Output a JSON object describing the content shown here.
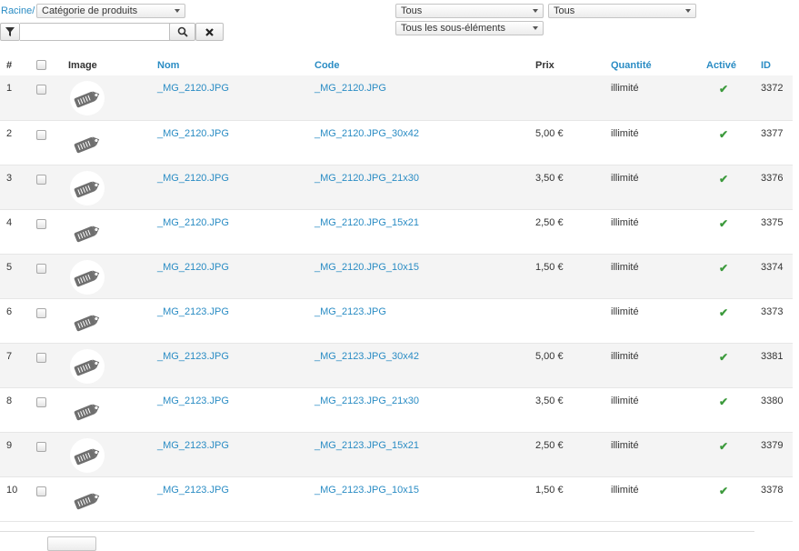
{
  "breadcrumb": {
    "root": "Racine/"
  },
  "filters": {
    "category_select": "Catégorie de produits",
    "select_tous_1": "Tous",
    "select_tous_2": "Tous",
    "select_subitems": "Tous les sous-éléments",
    "search_value": ""
  },
  "table": {
    "headers": {
      "index": "#",
      "image": "Image",
      "nom": "Nom",
      "code": "Code",
      "prix": "Prix",
      "quantite": "Quantité",
      "active": "Activé",
      "id": "ID"
    },
    "rows": [
      {
        "index": "1",
        "nom": "_MG_2120.JPG",
        "code": "_MG_2120.JPG",
        "prix": "",
        "quantite": "illimité",
        "active": true,
        "id": "3372"
      },
      {
        "index": "2",
        "nom": "_MG_2120.JPG",
        "code": "_MG_2120.JPG_30x42",
        "prix": "5,00 €",
        "quantite": "illimité",
        "active": true,
        "id": "3377"
      },
      {
        "index": "3",
        "nom": "_MG_2120.JPG",
        "code": "_MG_2120.JPG_21x30",
        "prix": "3,50 €",
        "quantite": "illimité",
        "active": true,
        "id": "3376"
      },
      {
        "index": "4",
        "nom": "_MG_2120.JPG",
        "code": "_MG_2120.JPG_15x21",
        "prix": "2,50 €",
        "quantite": "illimité",
        "active": true,
        "id": "3375"
      },
      {
        "index": "5",
        "nom": "_MG_2120.JPG",
        "code": "_MG_2120.JPG_10x15",
        "prix": "1,50 €",
        "quantite": "illimité",
        "active": true,
        "id": "3374"
      },
      {
        "index": "6",
        "nom": "_MG_2123.JPG",
        "code": "_MG_2123.JPG",
        "prix": "",
        "quantite": "illimité",
        "active": true,
        "id": "3373"
      },
      {
        "index": "7",
        "nom": "_MG_2123.JPG",
        "code": "_MG_2123.JPG_30x42",
        "prix": "5,00 €",
        "quantite": "illimité",
        "active": true,
        "id": "3381"
      },
      {
        "index": "8",
        "nom": "_MG_2123.JPG",
        "code": "_MG_2123.JPG_21x30",
        "prix": "3,50 €",
        "quantite": "illimité",
        "active": true,
        "id": "3380"
      },
      {
        "index": "9",
        "nom": "_MG_2123.JPG",
        "code": "_MG_2123.JPG_15x21",
        "prix": "2,50 €",
        "quantite": "illimité",
        "active": true,
        "id": "3379"
      },
      {
        "index": "10",
        "nom": "_MG_2123.JPG",
        "code": "_MG_2123.JPG_10x15",
        "prix": "1,50 €",
        "quantite": "illimité",
        "active": true,
        "id": "3378"
      }
    ]
  },
  "icons": {
    "filter": "funnel-icon",
    "search": "search-icon",
    "clear": "close-icon",
    "thumbnail": "price-tag-icon",
    "active": "checkmark-icon"
  },
  "colors": {
    "link": "#2a8cc4",
    "active_check": "#3c9a3c",
    "alt_row": "#f4f4f4"
  }
}
